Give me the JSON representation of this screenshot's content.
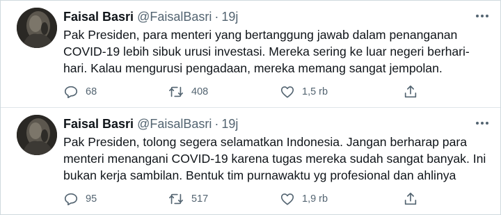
{
  "tweets": [
    {
      "name": "Faisal Basri",
      "handle": "@FaisalBasri",
      "separator": "·",
      "time": "19j",
      "lines": [
        "Pak Presiden, para menteri yang bertanggung jawab dalam penanganan",
        "COVID-19 lebih sibuk urusi investasi. Mereka sering ke luar negeri berhari-",
        "hari. Kalau mengurusi pengadaan, mereka memang sangat jempolan."
      ],
      "replies": "68",
      "retweets": "408",
      "likes": "1,5 rb"
    },
    {
      "name": "Faisal Basri",
      "handle": "@FaisalBasri",
      "separator": "·",
      "time": "19j",
      "lines": [
        "Pak Presiden, tolong segera selamatkan Indonesia. Jangan berharap para",
        "menteri menangani COVID-19 karena tugas mereka sudah sangat banyak. Ini",
        "bukan kerja sambilan. Bentuk tim purnawaktu yg profesional dan ahlinya"
      ],
      "replies": "95",
      "retweets": "517",
      "likes": "1,9 rb"
    }
  ],
  "icons": {
    "more": "more-horizontal-icon",
    "reply": "reply-bubble-icon",
    "retweet": "retweet-icon",
    "like": "heart-icon",
    "share": "share-upload-icon"
  },
  "colors": {
    "text": "#0f1419",
    "secondary": "#536471",
    "border": "#cfd9de"
  }
}
